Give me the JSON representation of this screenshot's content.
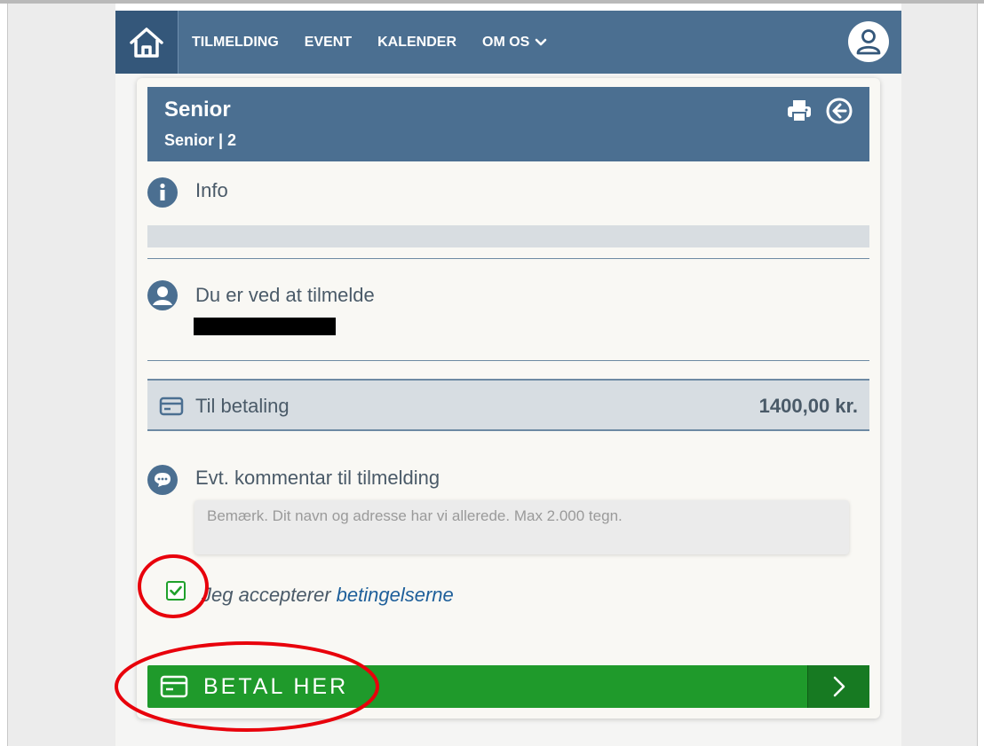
{
  "nav": {
    "links": [
      "TILMELDING",
      "EVENT",
      "KALENDER",
      "OM OS"
    ]
  },
  "card": {
    "title": "Senior",
    "subtitle": "Senior | 2"
  },
  "info": {
    "label": "Info"
  },
  "registrant": {
    "label": "Du er ved at tilmelde"
  },
  "payment": {
    "label": "Til betaling",
    "amount": "1400,00 kr."
  },
  "comment": {
    "label": "Evt. kommentar til tilmelding",
    "placeholder": "Bemærk. Dit navn og adresse har vi allerede. Max 2.000 tegn.",
    "value": ""
  },
  "terms": {
    "prefix": "Jeg accepterer ",
    "link": "betingelserne",
    "checked": true
  },
  "pay_button": {
    "label": "BETAL HER"
  },
  "colors": {
    "nav": "#4b6f91",
    "accent_green": "#1f9a2b",
    "link_blue": "#1e5f9a",
    "annotation_red": "#e8000b"
  }
}
